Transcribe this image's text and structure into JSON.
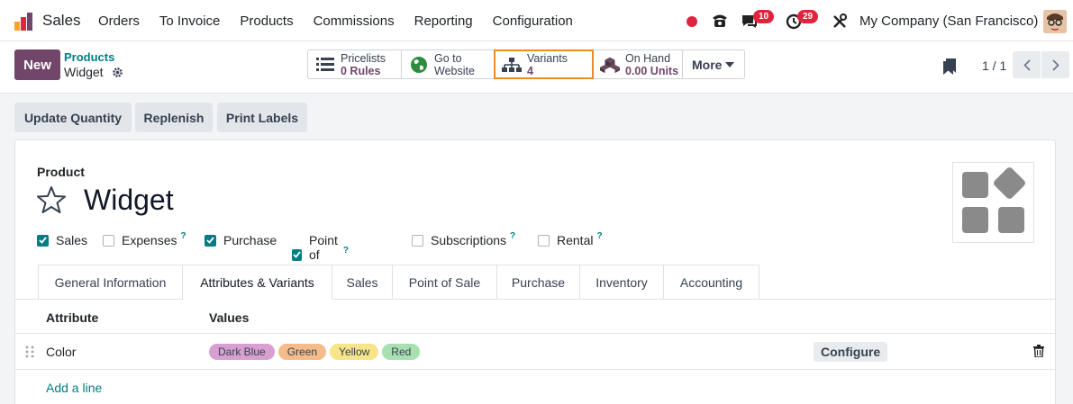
{
  "navbar": {
    "app_name": "Sales",
    "menu": [
      "Orders",
      "To Invoice",
      "Products",
      "Commissions",
      "Reporting",
      "Configuration"
    ],
    "messages_count": "10",
    "activities_count": "29",
    "company": "My Company (San Francisco)"
  },
  "control_panel": {
    "new_label": "New",
    "breadcrumb_parent": "Products",
    "breadcrumb_current": "Widget",
    "smart_buttons": [
      {
        "title": "Pricelists",
        "value": "0 Rules",
        "icon": "list-icon"
      },
      {
        "title": "Go to",
        "value": "Website",
        "icon": "globe-icon"
      },
      {
        "title": "Variants",
        "value": "4",
        "icon": "sitemap-icon"
      },
      {
        "title": "On Hand",
        "value": "0.00 Units",
        "icon": "cubes-icon"
      }
    ],
    "more_label": "More",
    "pager": "1 / 1"
  },
  "actions": [
    "Update Quantity",
    "Replenish",
    "Print Labels"
  ],
  "form": {
    "field_label": "Product",
    "product_name": "Widget",
    "checkboxes": [
      {
        "label": "Sales",
        "checked": true,
        "help": false
      },
      {
        "label": "Expenses",
        "checked": false,
        "help": true
      },
      {
        "label": "Purchase",
        "checked": true,
        "help": false
      },
      {
        "label": "Point of Sale",
        "checked": true,
        "help": true
      },
      {
        "label": "Subscriptions",
        "checked": false,
        "help": true
      },
      {
        "label": "Rental",
        "checked": false,
        "help": true
      }
    ],
    "help_mark": "?",
    "tabs": [
      "General Information",
      "Attributes & Variants",
      "Sales",
      "Point of Sale",
      "Purchase",
      "Inventory",
      "Accounting"
    ],
    "active_tab": "Attributes & Variants",
    "table": {
      "headers": [
        "Attribute",
        "Values"
      ],
      "rows": [
        {
          "attribute": "Color",
          "values": [
            {
              "label": "Dark Blue",
              "color": "#d8a0d0"
            },
            {
              "label": "Green",
              "color": "#f4bc8a"
            },
            {
              "label": "Yellow",
              "color": "#f7e58a"
            },
            {
              "label": "Red",
              "color": "#a8e0b0"
            }
          ],
          "configure_label": "Configure"
        }
      ],
      "add_line_label": "Add a line"
    }
  },
  "colors": {
    "brand": "#71466a",
    "link": "#017e84",
    "highlight": "#f08a24",
    "badge": "#e0243b"
  }
}
